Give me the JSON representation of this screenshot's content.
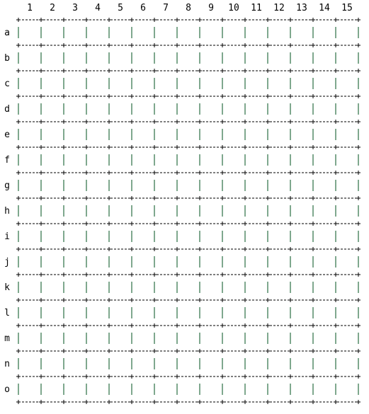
{
  "board": {
    "columns": [
      "1",
      "2",
      "3",
      "4",
      "5",
      "6",
      "7",
      "8",
      "9",
      "10",
      "11",
      "12",
      "13",
      "14",
      "15"
    ],
    "rows": [
      "a",
      "b",
      "c",
      "d",
      "e",
      "f",
      "g",
      "h",
      "i",
      "j",
      "k",
      "l",
      "m",
      "n",
      "o"
    ],
    "cells": [
      [
        "",
        "",
        "",
        "",
        "",
        "",
        "",
        "",
        "",
        "",
        "",
        "",
        "",
        "",
        ""
      ],
      [
        "",
        "",
        "",
        "",
        "",
        "",
        "",
        "",
        "",
        "",
        "",
        "",
        "",
        "",
        ""
      ],
      [
        "",
        "",
        "",
        "",
        "",
        "",
        "",
        "",
        "",
        "",
        "",
        "",
        "",
        "",
        ""
      ],
      [
        "",
        "",
        "",
        "",
        "",
        "",
        "",
        "",
        "",
        "",
        "",
        "",
        "",
        "",
        ""
      ],
      [
        "",
        "",
        "",
        "",
        "",
        "",
        "",
        "",
        "",
        "",
        "",
        "",
        "",
        "",
        ""
      ],
      [
        "",
        "",
        "",
        "",
        "",
        "",
        "",
        "",
        "",
        "",
        "",
        "",
        "",
        "",
        ""
      ],
      [
        "",
        "",
        "",
        "",
        "",
        "",
        "",
        "",
        "",
        "",
        "",
        "",
        "",
        "",
        ""
      ],
      [
        "",
        "",
        "",
        "",
        "",
        "",
        "",
        "",
        "",
        "",
        "",
        "",
        "",
        "",
        ""
      ],
      [
        "",
        "",
        "",
        "",
        "",
        "",
        "",
        "",
        "",
        "",
        "",
        "",
        "",
        "",
        ""
      ],
      [
        "",
        "",
        "",
        "",
        "",
        "",
        "",
        "",
        "",
        "",
        "",
        "",
        "",
        "",
        ""
      ],
      [
        "",
        "",
        "",
        "",
        "",
        "",
        "",
        "",
        "",
        "",
        "",
        "",
        "",
        "",
        ""
      ],
      [
        "",
        "",
        "",
        "",
        "",
        "",
        "",
        "",
        "",
        "",
        "",
        "",
        "",
        "",
        ""
      ],
      [
        "",
        "",
        "",
        "",
        "",
        "",
        "",
        "",
        "",
        "",
        "",
        "",
        "",
        "",
        ""
      ],
      [
        "",
        "",
        "",
        "",
        "",
        "",
        "",
        "",
        "",
        "",
        "",
        "",
        "",
        "",
        ""
      ],
      [
        "",
        "",
        "",
        "",
        "",
        "",
        "",
        "",
        "",
        "",
        "",
        "",
        "",
        "",
        ""
      ]
    ],
    "colors": {
      "grid_dash": "#000000",
      "cell_divider": "#3a7a52",
      "label": "#000000",
      "background": "#ffffff"
    }
  }
}
